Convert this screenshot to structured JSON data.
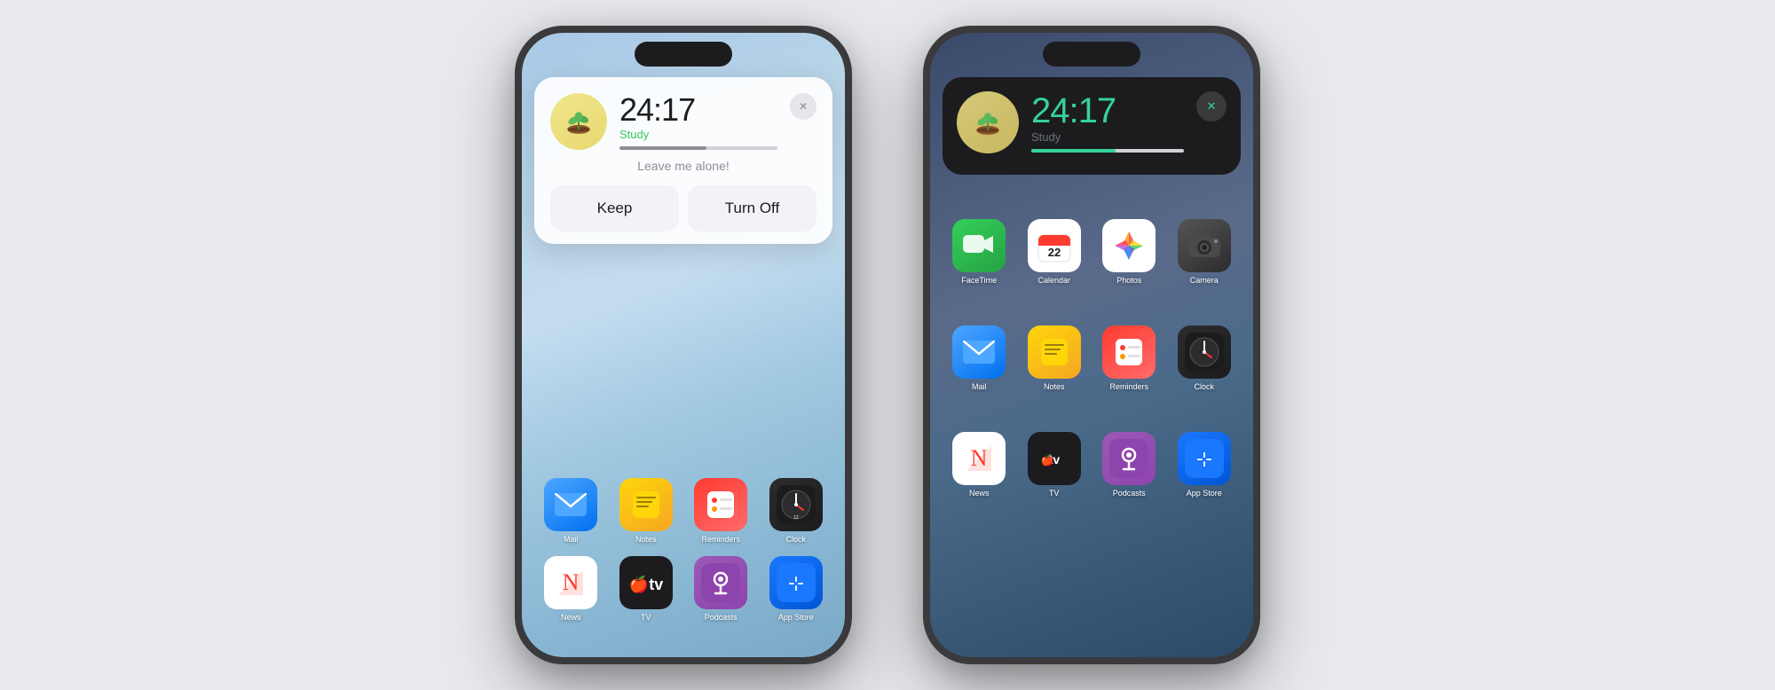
{
  "page": {
    "bg_color": "#e8eaed"
  },
  "phone_left": {
    "type": "light",
    "timer": {
      "time": "24:17",
      "label": "Study",
      "progress": 55,
      "leave_text": "Leave me alone!",
      "btn_keep": "Keep",
      "btn_turn_off": "Turn Off"
    },
    "apps_row1": [
      {
        "name": "Mail",
        "icon": "mail"
      },
      {
        "name": "Notes",
        "icon": "notes"
      },
      {
        "name": "Reminders",
        "icon": "reminders"
      },
      {
        "name": "Clock",
        "icon": "clock"
      }
    ],
    "apps_row2": [
      {
        "name": "News",
        "icon": "news"
      },
      {
        "name": "TV",
        "icon": "tv"
      },
      {
        "name": "Podcasts",
        "icon": "podcasts"
      },
      {
        "name": "App Store",
        "icon": "appstore"
      }
    ]
  },
  "phone_right": {
    "type": "dark",
    "timer": {
      "time": "24:17",
      "label": "Study",
      "progress": 55
    },
    "apps_row1": [
      {
        "name": "FaceTime",
        "icon": "facetime"
      },
      {
        "name": "Calendar",
        "icon": "calendar"
      },
      {
        "name": "Photos",
        "icon": "photos"
      },
      {
        "name": "Camera",
        "icon": "camera"
      }
    ],
    "apps_row2": [
      {
        "name": "Mail",
        "icon": "mail"
      },
      {
        "name": "Notes",
        "icon": "notes"
      },
      {
        "name": "Reminders",
        "icon": "reminders"
      },
      {
        "name": "Clock",
        "icon": "clock"
      }
    ],
    "apps_row3": [
      {
        "name": "News",
        "icon": "news"
      },
      {
        "name": "TV",
        "icon": "tv"
      },
      {
        "name": "Podcasts",
        "icon": "podcasts"
      },
      {
        "name": "App Store",
        "icon": "appstore"
      }
    ]
  }
}
